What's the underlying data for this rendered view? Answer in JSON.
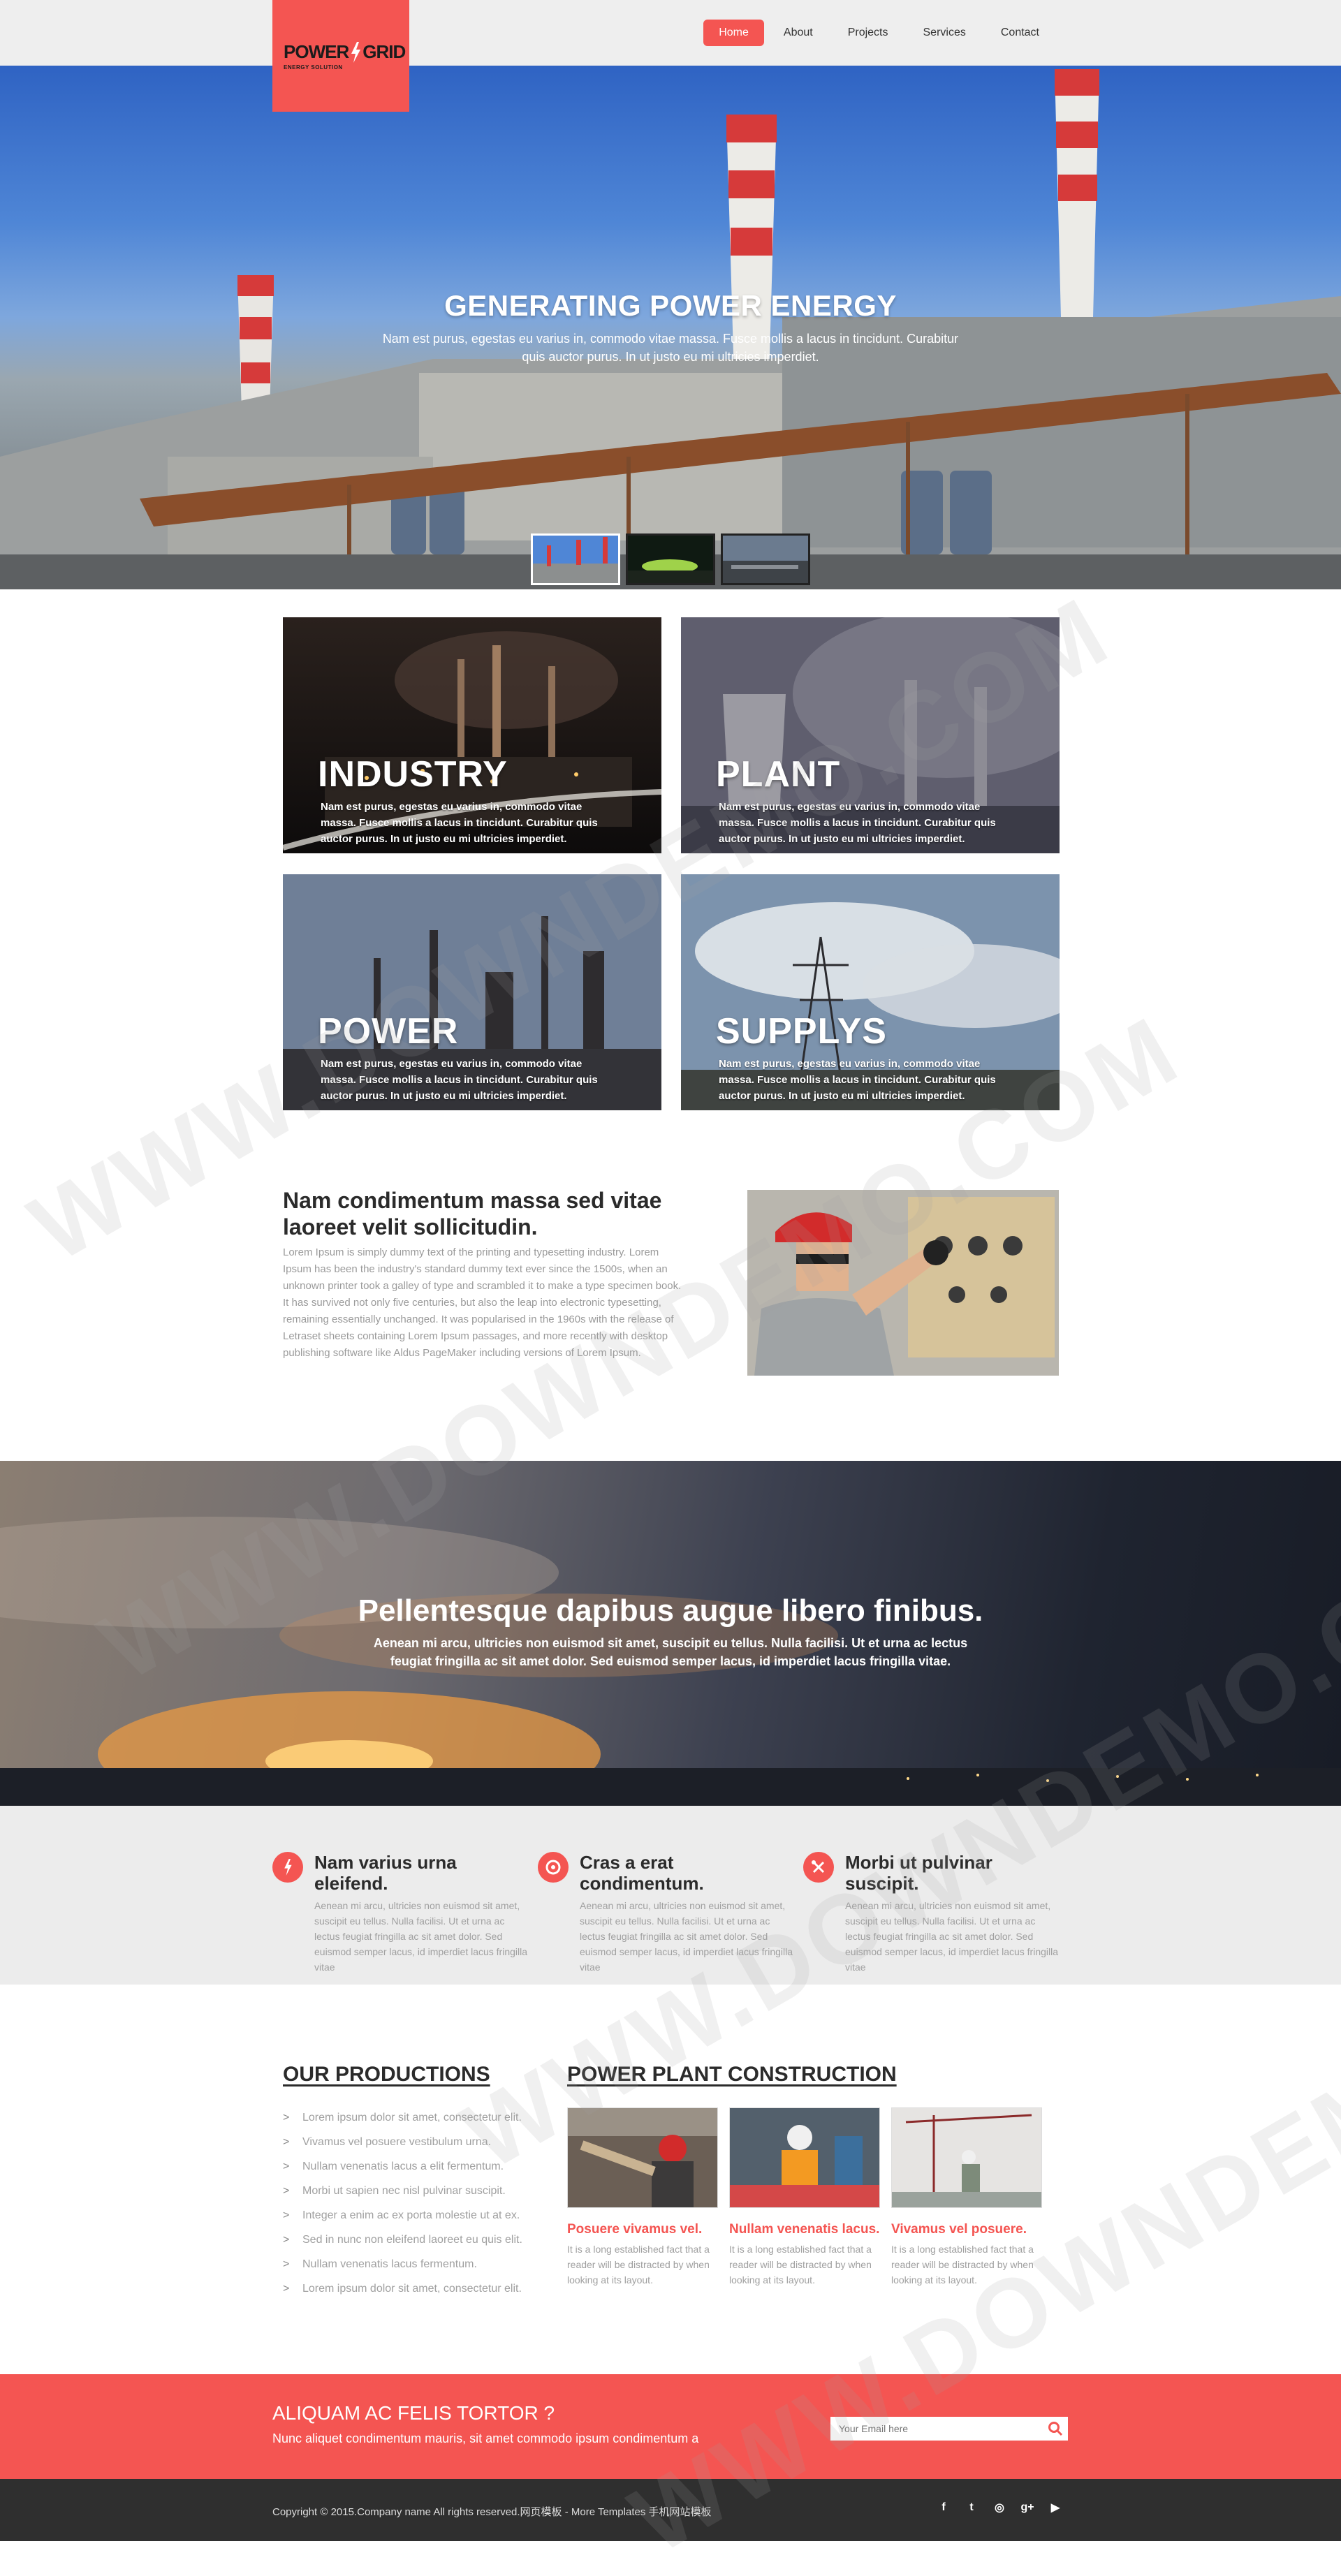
{
  "header": {
    "logo_text_left": "POWER",
    "logo_text_right": "GRID",
    "logo_tagline": "ENERGY SOLUTION",
    "nav": [
      {
        "label": "Home",
        "active": true
      },
      {
        "label": "About",
        "active": false
      },
      {
        "label": "Projects",
        "active": false
      },
      {
        "label": "Services",
        "active": false
      },
      {
        "label": "Contact",
        "active": false
      }
    ]
  },
  "hero": {
    "title": "GENERATING POWER ENERGY",
    "text": "Nam est purus, egestas eu varius in, commodo vitae massa. Fusce mollis a lacus in tincidunt. Curabitur quis auctor purus. In ut justo eu mi ultricies imperdiet."
  },
  "tiles": [
    {
      "title": "INDUSTRY",
      "text": "Nam est purus, egestas eu varius in, commodo vitae massa. Fusce mollis a lacus in tincidunt. Curabitur quis auctor purus. In ut justo eu mi ultricies imperdiet."
    },
    {
      "title": "PLANT",
      "text": "Nam est purus, egestas eu varius in, commodo vitae massa. Fusce mollis a lacus in tincidunt. Curabitur quis auctor purus. In ut justo eu mi ultricies imperdiet."
    },
    {
      "title": "POWER",
      "text": "Nam est purus, egestas eu varius in, commodo vitae massa. Fusce mollis a lacus in tincidunt. Curabitur quis auctor purus. In ut justo eu mi ultricies imperdiet."
    },
    {
      "title": "SUPPLYS",
      "text": "Nam est purus, egestas eu varius in, commodo vitae massa. Fusce mollis a lacus in tincidunt. Curabitur quis auctor purus. In ut justo eu mi ultricies imperdiet."
    }
  ],
  "about": {
    "title": "Nam condimentum massa sed vitae laoreet velit sollicitudin.",
    "text": "Lorem Ipsum is simply dummy text of the printing and typesetting industry. Lorem Ipsum has been the industry's standard dummy text ever since the 1500s, when an unknown printer took a galley of type and scrambled it to make a type specimen book. It has survived not only five centuries, but also the leap into electronic typesetting, remaining essentially unchanged. It was popularised in the 1960s with the release of Letraset sheets containing Lorem Ipsum passages, and more recently with desktop publishing software like Aldus PageMaker including versions of Lorem Ipsum."
  },
  "banner": {
    "title": "Pellentesque dapibus augue libero finibus.",
    "text": "Aenean mi arcu, ultricies non euismod sit amet, suscipit eu tellus. Nulla facilisi. Ut et urna ac lectus feugiat fringilla ac sit amet dolor. Sed euismod semper lacus, id imperdiet lacus fringilla vitae."
  },
  "features": [
    {
      "icon": "bolt-icon",
      "title": "Nam varius urna eleifend.",
      "text": "Aenean mi arcu, ultricies non euismod sit amet, suscipit eu tellus. Nulla facilisi. Ut et urna ac lectus feugiat fringilla ac sit amet dolor. Sed euismod semper lacus, id imperdiet lacus fringilla vitae"
    },
    {
      "icon": "target-icon",
      "title": "Cras a erat condimentum.",
      "text": "Aenean mi arcu, ultricies non euismod sit amet, suscipit eu tellus. Nulla facilisi. Ut et urna ac lectus feugiat fringilla ac sit amet dolor. Sed euismod semper lacus, id imperdiet lacus fringilla vitae"
    },
    {
      "icon": "tools-icon",
      "title": "Morbi ut pulvinar suscipit.",
      "text": "Aenean mi arcu, ultricies non euismod sit amet, suscipit eu tellus. Nulla facilisi. Ut et urna ac lectus feugiat fringilla ac sit amet dolor. Sed euismod semper lacus, id imperdiet lacus fringilla vitae"
    }
  ],
  "productions": {
    "title": "OUR PRODUCTIONS",
    "chevron": ">",
    "items": [
      "Lorem ipsum dolor sit amet, consectetur elit.",
      "Vivamus vel posuere vestibulum urna.",
      "Nullam venenatis lacus a elit fermentum.",
      "Morbi ut sapien nec nisl pulvinar suscipit.",
      "Integer a enim ac ex porta molestie ut at ex.",
      "Sed in nunc non eleifend laoreet eu quis elit.",
      "Nullam venenatis lacus fermentum.",
      "Lorem ipsum dolor sit amet, consectetur elit."
    ]
  },
  "construction": {
    "title": "POWER PLANT CONSTRUCTION",
    "cards": [
      {
        "title": "Posuere vivamus vel.",
        "text": "It is a long established fact that a reader will be distracted by when looking at its layout."
      },
      {
        "title": "Nullam venenatis lacus.",
        "text": "It is a long established fact that a reader will be distracted by when looking at its layout."
      },
      {
        "title": "Vivamus vel posuere.",
        "text": "It is a long established fact that a reader will be distracted by when looking at its layout."
      }
    ]
  },
  "cta": {
    "title": "ALIQUAM AC FELIS TORTOR ?",
    "text": "Nunc aliquet condimentum mauris, sit amet commodo ipsum condimentum a",
    "email_placeholder": "Your Email here"
  },
  "footer": {
    "copyright": "Copyright © 2015.Company name All rights reserved.网页模板 - More Templates 手机网站模板",
    "social": [
      {
        "icon": "facebook-icon",
        "glyph": "f"
      },
      {
        "icon": "twitter-icon",
        "glyph": "t"
      },
      {
        "icon": "dribbble-icon",
        "glyph": "◎"
      },
      {
        "icon": "google-plus-icon",
        "glyph": "g+"
      },
      {
        "icon": "youtube-icon",
        "glyph": "▶"
      }
    ]
  },
  "watermark": "WWW.DOWNDEMO.COM",
  "colors": {
    "accent": "#f45552",
    "header_bg": "#eeeeee",
    "footer_bg": "#2f2f2f",
    "features_bg": "#ececec"
  }
}
